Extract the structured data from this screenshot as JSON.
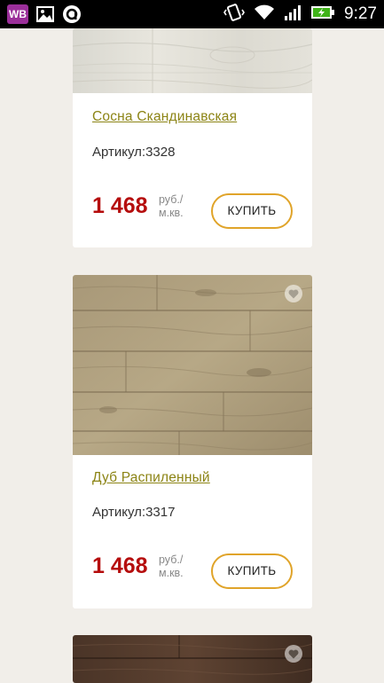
{
  "status_bar": {
    "time": "9:27",
    "app_icon_label": "WB",
    "icons": [
      "wb-app-icon",
      "gallery-icon",
      "circle-a-icon",
      "vibrate-icon",
      "wifi-icon",
      "signal-icon",
      "battery-charging-icon"
    ]
  },
  "colors": {
    "title": "#8c8415",
    "price": "#b50d0d",
    "button_border": "#e0a42a",
    "background": "#f1eee9"
  },
  "products": [
    {
      "name": "Сосна Скандинавская",
      "sku": "Артикул:3328",
      "price": "1 468",
      "unit_line1": "руб./",
      "unit_line2": "м.кв.",
      "buy_label": "КУПИТЬ"
    },
    {
      "name": "Дуб Распиленный",
      "sku": "Артикул:3317",
      "price": "1 468",
      "unit_line1": "руб./",
      "unit_line2": "м.кв.",
      "buy_label": "КУПИТЬ"
    },
    {
      "name": "",
      "sku": "",
      "price": "",
      "unit_line1": "",
      "unit_line2": "",
      "buy_label": ""
    }
  ]
}
